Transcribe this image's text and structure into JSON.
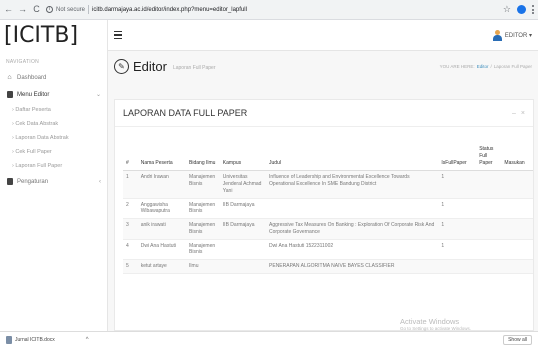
{
  "browser": {
    "back": "←",
    "forward": "→",
    "reload": "C",
    "not_secure": "Not secure",
    "url": "icitb.darmajaya.ac.id/editor/index.php?menu=editor_lapfull"
  },
  "app": {
    "logo": "[ICITB]",
    "user_label": "EDITOR ▾"
  },
  "sidebar": {
    "heading": "NAVIGATION",
    "dashboard": "Dashboard",
    "menu_editor": "Menu Editor",
    "sub_items": [
      "Daftar Peserta",
      "Cek Data Abstrak",
      "Laporan Data Abstrak",
      "Cek Full Paper",
      "Laporan Full Paper"
    ],
    "pengaturan": "Pengaturan"
  },
  "page": {
    "title": "Editor",
    "subtitle": "Laporan Full Paper",
    "breadcrumb_prefix": "YOU ARE HERE:",
    "breadcrumb_link": "Editor",
    "breadcrumb_sep": "/",
    "breadcrumb_current": "Laporan Full Paper"
  },
  "panel": {
    "title": "LAPORAN DATA FULL PAPER",
    "minimize": "–",
    "close": "×"
  },
  "table": {
    "headers": {
      "no": "#",
      "nama": "Nama Peserta",
      "bidang": "Bidang Ilmu",
      "kampus": "Kampus",
      "judul": "Judul",
      "isfull": "IsFullPaper",
      "status": "Status Full Paper",
      "masukan": "Masukan"
    },
    "rows": [
      {
        "no": "1",
        "nama": "Andri Irawan",
        "bidang": "Manajemen Bisnis",
        "kampus": "Universitas Jenderal Achmad Yani",
        "judul": "Influence of Leadership and Environmental Excellence Towards Operational Excellence In SME Bandung District",
        "isfull": "1",
        "status": "",
        "masukan": ""
      },
      {
        "no": "2",
        "nama": "Anggawisha Wibawaputra",
        "bidang": "Manajemen Bisnis",
        "kampus": "IIB Darmajaya",
        "judul": "",
        "isfull": "1",
        "status": "",
        "masukan": ""
      },
      {
        "no": "3",
        "nama": "anik irawati",
        "bidang": "Manajemen Bisnis",
        "kampus": "IIB Darmajaya",
        "judul": "Aggressive Tax Measures On Banking : Exploration Of Corporate Risk And Corporate Governance",
        "isfull": "1",
        "status": "",
        "masukan": ""
      },
      {
        "no": "4",
        "nama": "Dwi Ana Hastuti",
        "bidang": "Manajemen Bisnis",
        "kampus": "",
        "judul": "Dwi Ana Hastuti 1522311002",
        "isfull": "1",
        "status": "",
        "masukan": ""
      },
      {
        "no": "5",
        "nama": "ketut artaye",
        "bidang": "Ilmu",
        "kampus": "",
        "judul": "PENERAPAN ALGORITMA NAIVE BAYES CLASSIFIER",
        "isfull": "",
        "status": "",
        "masukan": ""
      }
    ]
  },
  "watermark": {
    "title": "Activate Windows",
    "subtitle": "Go to Settings to activate Windows."
  },
  "downloads": {
    "file_name": "Jurnal ICITB.docx",
    "show_all": "Show all"
  }
}
